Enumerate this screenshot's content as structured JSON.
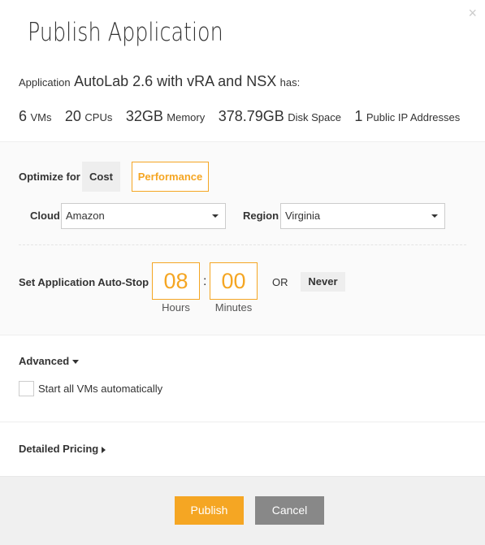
{
  "dialog": {
    "title": "Publish Application",
    "close_glyph": "×"
  },
  "application": {
    "prefix": "Application",
    "name": "AutoLab 2.6 with vRA and NSX",
    "suffix": "has:"
  },
  "stats": [
    {
      "value": "6",
      "label": "VMs"
    },
    {
      "value": "20",
      "label": "CPUs"
    },
    {
      "value": "32GB",
      "label": "Memory"
    },
    {
      "value": "378.79GB",
      "label": "Disk Space"
    },
    {
      "value": "1",
      "label": "Public IP Addresses"
    }
  ],
  "optimize": {
    "label": "Optimize for",
    "options": [
      "Cost",
      "Performance"
    ],
    "selected": "Performance"
  },
  "cloud": {
    "label": "Cloud",
    "value": "Amazon"
  },
  "region": {
    "label": "Region",
    "value": "Virginia"
  },
  "autostop": {
    "label": "Set Application Auto-Stop",
    "hours": "08",
    "minutes": "00",
    "hours_label": "Hours",
    "minutes_label": "Minutes",
    "separator": ":",
    "or_text": "OR",
    "never_label": "Never"
  },
  "advanced": {
    "label": "Advanced",
    "start_all_label": "Start all VMs automatically"
  },
  "pricing": {
    "label": "Detailed Pricing"
  },
  "footer": {
    "publish_label": "Publish",
    "cancel_label": "Cancel"
  },
  "colors": {
    "accent": "#f5a623",
    "cancel": "#888888"
  }
}
